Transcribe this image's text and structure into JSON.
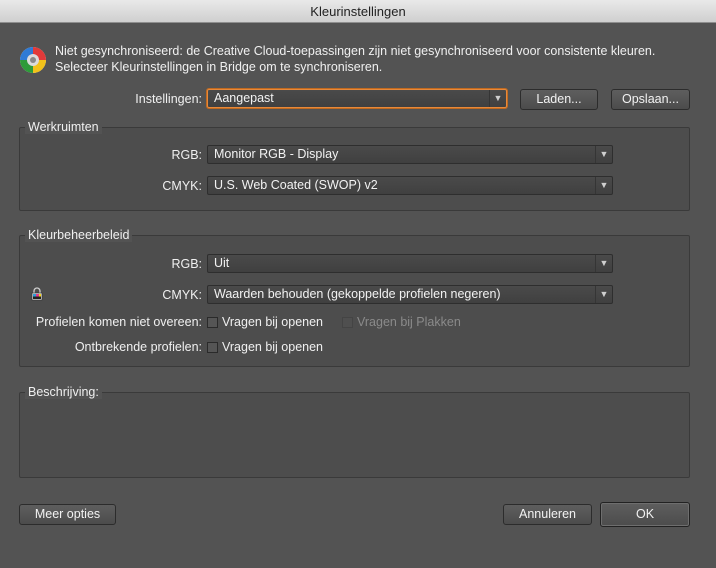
{
  "window": {
    "title": "Kleurinstellingen"
  },
  "sync_message": {
    "line1": "Niet gesynchroniseerd: de Creative Cloud-toepassingen zijn niet gesynchroniseerd voor consistente kleuren.",
    "line2": "Selecteer Kleurinstellingen in Bridge om te synchroniseren."
  },
  "settings": {
    "label": "Instellingen:",
    "value": "Aangepast",
    "load_label": "Laden...",
    "save_label": "Opslaan..."
  },
  "workspaces": {
    "title": "Werkruimten",
    "rgb_label": "RGB:",
    "rgb_value": "Monitor RGB - Display",
    "cmyk_label": "CMYK:",
    "cmyk_value": "U.S. Web Coated (SWOP) v2"
  },
  "policies": {
    "title": "Kleurbeheerbeleid",
    "rgb_label": "RGB:",
    "rgb_value": "Uit",
    "cmyk_label": "CMYK:",
    "cmyk_value": "Waarden behouden (gekoppelde profielen negeren)",
    "mismatch_label": "Profielen komen niet overeen:",
    "ask_open_label": "Vragen bij openen",
    "ask_paste_label": "Vragen bij Plakken",
    "missing_label": "Ontbrekende profielen:",
    "missing_ask_open_label": "Vragen bij openen"
  },
  "description": {
    "title": "Beschrijving:"
  },
  "footer": {
    "more_options_label": "Meer opties",
    "cancel_label": "Annuleren",
    "ok_label": "OK"
  },
  "colors": {
    "focus_accent": "#e8893a",
    "background": "#535353"
  },
  "icons": {
    "sync": "color-wheel-icon",
    "lock": "lock-icon",
    "dropdown": "chevron-down-icon"
  }
}
